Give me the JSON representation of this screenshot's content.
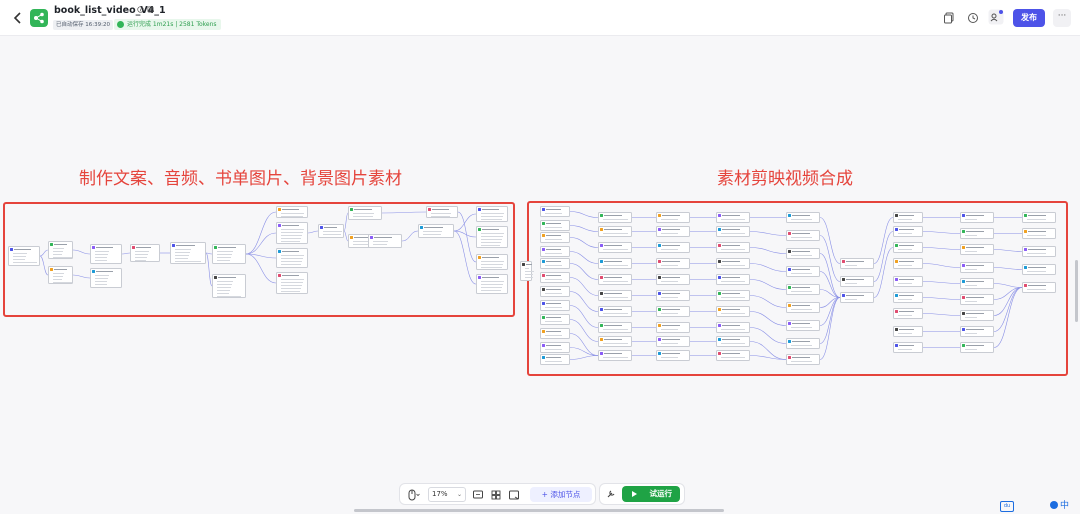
{
  "header": {
    "title": "book_list_video_V4_1",
    "autosave": "已自动保存 16:39:20",
    "run_status": "运行完成 1m21s | 2581 Tokens",
    "publish_label": "发布",
    "more_label": "···"
  },
  "canvas": {
    "annotations": [
      "制作文案、音频、书单图片、背景图片素材",
      "素材剪映视频合成"
    ]
  },
  "toolbar": {
    "zoom": "17%",
    "add_node_label": "添加节点",
    "trial_run_label": "试运行"
  },
  "corner": {
    "badge": "du",
    "ime": "中"
  },
  "colors": {
    "accent": "#4d53e8",
    "success": "#1fa345",
    "annotation": "#e5443c"
  },
  "icons": [
    "back-icon",
    "app-logo-icon",
    "info-icon",
    "edit-icon",
    "copy-icon",
    "history-icon",
    "collaborators-icon",
    "mouse-icon",
    "comment-icon",
    "minimap-icon",
    "fit-view-icon",
    "tools-icon",
    "play-icon"
  ]
}
